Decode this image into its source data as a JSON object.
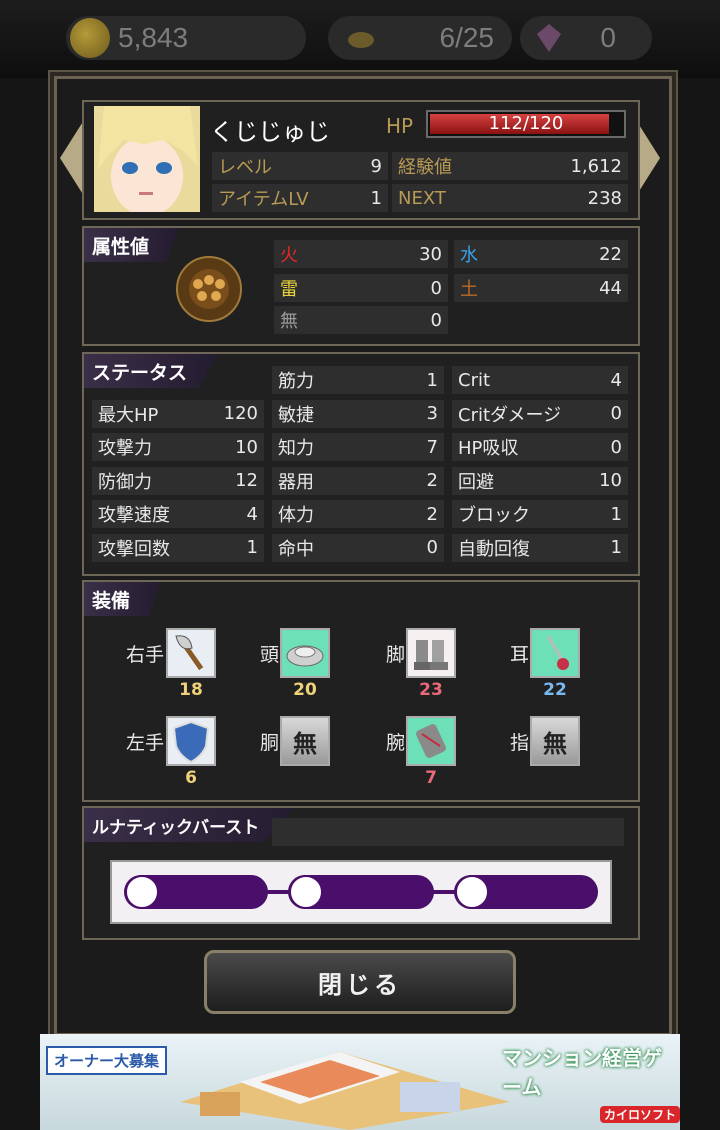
{
  "topbar": {
    "coins": "5,843",
    "stamina": "6/25",
    "gems": "0"
  },
  "character": {
    "name": "くじじゅじ",
    "hp_label": "HP",
    "hp_value": "112/120",
    "hp_fraction": 0.9333,
    "rows": [
      {
        "label": "レベル",
        "value": "9"
      },
      {
        "label": "アイテムLV",
        "value": "1"
      },
      {
        "label": "経験値",
        "value": "1,612"
      },
      {
        "label": "NEXT",
        "value": "238"
      }
    ]
  },
  "attributes": {
    "title": "属性値",
    "items": [
      {
        "label": "火",
        "value": "30",
        "color": "#e3262a"
      },
      {
        "label": "水",
        "value": "22",
        "color": "#3aa0e8"
      },
      {
        "label": "雷",
        "value": "0",
        "color": "#e8d23a"
      },
      {
        "label": "土",
        "value": "44",
        "color": "#b86a28"
      },
      {
        "label": "無",
        "value": "0",
        "color": "#9a9a9a"
      }
    ]
  },
  "status": {
    "title": "ステータス",
    "col1": [
      {
        "label": "最大HP",
        "value": "120"
      },
      {
        "label": "攻撃力",
        "value": "10"
      },
      {
        "label": "防御力",
        "value": "12"
      },
      {
        "label": "攻撃速度",
        "value": "4"
      },
      {
        "label": "攻撃回数",
        "value": "1"
      }
    ],
    "col2": [
      {
        "label": "筋力",
        "value": "1"
      },
      {
        "label": "敏捷",
        "value": "3"
      },
      {
        "label": "知力",
        "value": "7"
      },
      {
        "label": "器用",
        "value": "2"
      },
      {
        "label": "体力",
        "value": "2"
      },
      {
        "label": "命中",
        "value": "0"
      }
    ],
    "col3": [
      {
        "label": "Crit",
        "value": "4"
      },
      {
        "label": "Critダメージ",
        "value": "0"
      },
      {
        "label": "HP吸収",
        "value": "0"
      },
      {
        "label": "回避",
        "value": "10"
      },
      {
        "label": "ブロック",
        "value": "1"
      },
      {
        "label": "自動回復",
        "value": "1"
      }
    ]
  },
  "equipment": {
    "title": "装備",
    "slots": [
      {
        "label": "右手",
        "icon": "axe-icon",
        "value": "18",
        "numColor": "#f0d078"
      },
      {
        "label": "頭",
        "icon": "helmet-icon",
        "value": "20",
        "numColor": "#f0d078"
      },
      {
        "label": "脚",
        "icon": "boots-icon",
        "value": "23",
        "numColor": "#e86a78"
      },
      {
        "label": "耳",
        "icon": "earring-icon",
        "value": "22",
        "numColor": "#7ab8f0"
      },
      {
        "label": "左手",
        "icon": "shield-icon",
        "value": "6",
        "numColor": "#f0d078"
      },
      {
        "label": "胴",
        "icon": "none",
        "value": "",
        "numColor": "#f0d078",
        "none_text": "無"
      },
      {
        "label": "腕",
        "icon": "gauntlet-icon",
        "value": "7",
        "numColor": "#e86a78"
      },
      {
        "label": "指",
        "icon": "none",
        "value": "",
        "numColor": "#f0d078",
        "none_text": "無"
      }
    ]
  },
  "lunatic": {
    "title": "ルナティックバースト"
  },
  "close_label": "閉じる",
  "ad": {
    "left": "オーナー大募集",
    "right": "マンション経営ゲーム",
    "brand": "カイロソフト"
  }
}
